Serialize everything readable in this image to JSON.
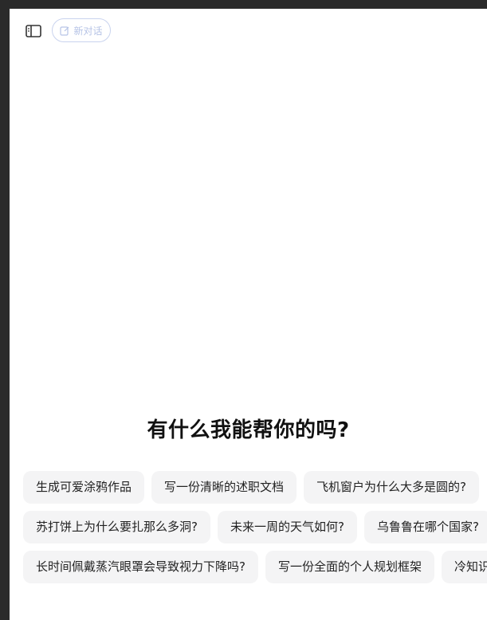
{
  "header": {
    "new_chat_label": "新对话"
  },
  "main": {
    "headline": "有什么我能帮你的吗?"
  },
  "suggestions": {
    "row1": [
      "生成可爱涂鸦作品",
      "写一份清晰的述职文档",
      "飞机窗户为什么大多是圆的?"
    ],
    "row2": [
      "苏打饼上为什么要扎那么多洞?",
      "未来一周的天气如何?",
      "乌鲁鲁在哪个国家?"
    ],
    "row3": [
      "长时间佩戴蒸汽眼罩会导致视力下降吗?",
      "写一份全面的个人规划框架",
      "冷知识"
    ]
  },
  "colors": {
    "accent_border": "#c9d3ee",
    "accent_text": "#b6c3e6",
    "chip_bg": "#f4f4f5"
  },
  "icons": {
    "sidebar": "sidebar-toggle-icon",
    "new_chat": "edit-icon"
  }
}
